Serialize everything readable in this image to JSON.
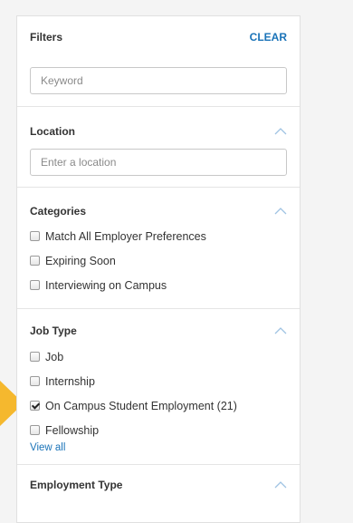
{
  "filters": {
    "title": "Filters",
    "clear_label": "CLEAR",
    "keyword_placeholder": "Keyword"
  },
  "location": {
    "title": "Location",
    "placeholder": "Enter a location"
  },
  "categories": {
    "title": "Categories",
    "options": [
      {
        "label": "Match All Employer Preferences",
        "checked": false
      },
      {
        "label": "Expiring Soon",
        "checked": false
      },
      {
        "label": "Interviewing on Campus",
        "checked": false
      }
    ]
  },
  "job_type": {
    "title": "Job Type",
    "options": [
      {
        "label": "Job",
        "checked": false
      },
      {
        "label": "Internship",
        "checked": false
      },
      {
        "label": "On Campus Student Employment (21)",
        "checked": true
      },
      {
        "label": "Fellowship",
        "checked": false
      }
    ],
    "view_all": "View all"
  },
  "employment_type": {
    "title": "Employment Type"
  },
  "colors": {
    "accent": "#1a73b8",
    "highlight_arrow": "#f5b82e"
  }
}
